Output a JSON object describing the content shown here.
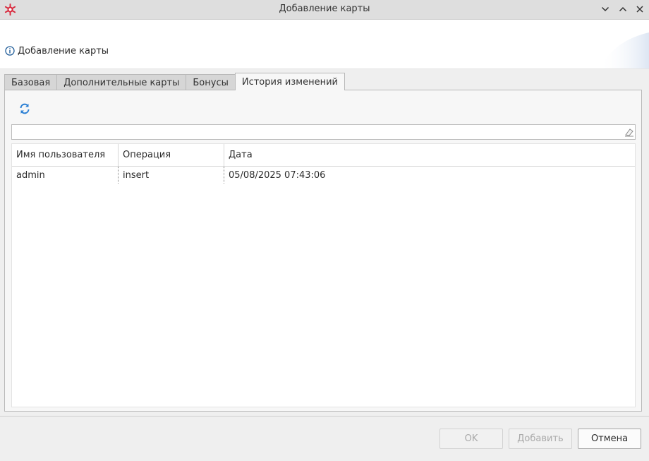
{
  "window": {
    "title": "Добавление карты",
    "controls": [
      "chevron-down-icon",
      "chevron-up-icon",
      "close-icon"
    ]
  },
  "header": {
    "title": "Добавление карты",
    "icon": "info-icon"
  },
  "tabs": [
    {
      "label": "Базовая",
      "active": false
    },
    {
      "label": "Дополнительные карты",
      "active": false
    },
    {
      "label": "Бонусы",
      "active": false
    },
    {
      "label": "История изменений",
      "active": true
    }
  ],
  "toolbar": {
    "refresh_icon": "refresh-icon"
  },
  "filter": {
    "value": "",
    "placeholder": ""
  },
  "table": {
    "columns": [
      "Имя пользователя",
      "Операция",
      "Дата"
    ],
    "rows": [
      [
        "admin",
        "insert",
        "05/08/2025 07:43:06"
      ]
    ]
  },
  "buttons": {
    "ok": "OK",
    "add": "Добавить",
    "cancel": "Отмена"
  },
  "colors": {
    "app_icon": "#d8263a",
    "refresh_icon": "#2a7fd4",
    "info_icon": "#1f5c99"
  }
}
